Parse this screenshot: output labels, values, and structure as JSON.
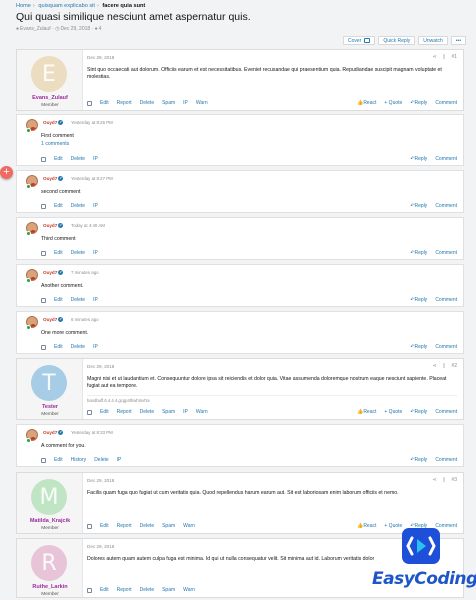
{
  "breadcrumbs": [
    "Home",
    "quisquam explicabo sit",
    "facere quia sunt"
  ],
  "title": "Qui quasi similique nesciunt amet aspernatur quis.",
  "meta": {
    "author": "Evans_Zulauf",
    "date": "Dec 29, 2018",
    "count": "4"
  },
  "toolbar": {
    "cover": "Cover",
    "quick_reply": "Quick Reply",
    "unwatch": "Unwatch",
    "more": "•••"
  },
  "labels": {
    "edit": "Edit",
    "report": "Report",
    "delete": "Delete",
    "spam": "Spam",
    "ip": "IP",
    "warn": "Warn",
    "react": "React",
    "quote": "+ Quote",
    "reply": "Reply",
    "comment": "Comment",
    "history": "History"
  },
  "posts": [
    {
      "avatar_letter": "E",
      "avatar_color": "#ecdcc0",
      "user": "Evans_Zulauf",
      "role": "Member",
      "date": "Dec 29, 2018",
      "text": "Sint quo occaecati aut dolorum. Officiis earum et est necessitatibus. Eveniet recusandae qui praesentium quia. Repudiandae suscipit magnam voluptate et molestias."
    },
    {
      "avatar_letter": "T",
      "avatar_color": "#a7cce6",
      "user": "Tester",
      "role": "Member",
      "date": "Dec 29, 2018",
      "text": "Magni nisi et ut laudantium et. Consequuntur dolore ipsa sit reiciendis et dolor quia. Vitae assumenda doloremque nostrum eaque nesciunt sapiente. Placeat fugiat aut ea tempore.",
      "signature": "handbuff.6.4.4.4.gcgp4thwhtnvhtv"
    },
    {
      "avatar_letter": "M",
      "avatar_color": "#bfe5c4",
      "user": "Matilda_Krajcik",
      "role": "Member",
      "date": "Dec 29, 2018",
      "text": "Facilis quam fuga quo fugiat ut cum veritatis quia. Quod repellendus harum earum aut. Sit est laboriosam enim laborum officiis et nemo."
    },
    {
      "avatar_letter": "R",
      "avatar_color": "#e8c4d8",
      "user": "Ruthe_Larkin",
      "role": "Member",
      "date": "Dec 29, 2018",
      "text": "Dolores autem quam autem culpa fuga est minima. Id qui ut nulla consequatur velit. Sit minima aut id. Laborum veritatis dolor"
    }
  ],
  "comments": [
    {
      "user": "Ouyd7",
      "time": "Yesterday at 8:26 PM",
      "text": "First comment",
      "link": "1 comments"
    },
    {
      "user": "Ouyd7",
      "time": "Yesterday at 8:27 PM",
      "text": "second comment"
    },
    {
      "user": "Ouyd7",
      "time": "Today at 4:40 AM",
      "text": "Third comment"
    },
    {
      "user": "Ouyd7",
      "time": "7 minutes ago",
      "text": "Another comment."
    },
    {
      "user": "Ouyd7",
      "time": "6 minutes ago",
      "text": "One more comment."
    },
    {
      "user": "Ouyd7",
      "time": "Yesterday at 8:33 PM",
      "text": "A comment for you."
    }
  ],
  "brand": "EasyCoding.fr",
  "colors": {
    "link": "#2577b1",
    "username": "#9b2a9b",
    "brand": "#1e56c8"
  }
}
